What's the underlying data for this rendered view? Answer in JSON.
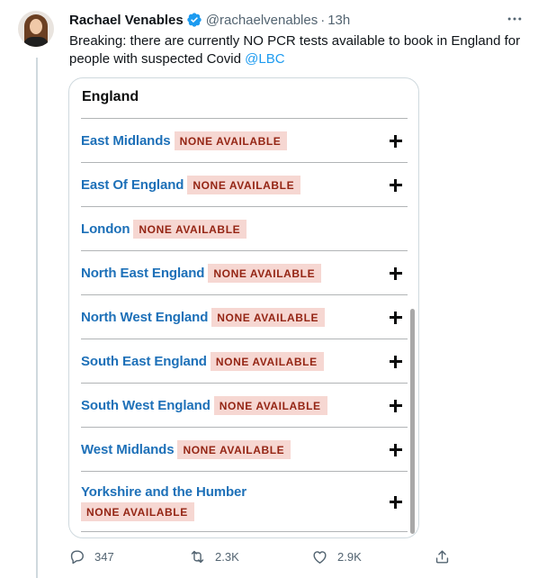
{
  "tweet": {
    "author_name": "Rachael Venables",
    "handle": "@rachaelvenables",
    "separator": "·",
    "time": "13h",
    "text": "Breaking: there are currently NO PCR tests available to book in England for people with suspected Covid ",
    "mention": "@LBC",
    "more_icon": "more-horizontal-icon",
    "verified_icon": "verified-badge-icon",
    "colors": {
      "accent": "#1d9bf0",
      "verified": "#1d9bf0",
      "secondary_text": "#536471"
    }
  },
  "card": {
    "title": "England",
    "status_label": "NONE AVAILABLE",
    "colors": {
      "region_link": "#1d70b8",
      "tag_bg": "#f6d7d2",
      "tag_text": "#942514"
    },
    "regions": [
      {
        "name": "East Midlands",
        "status": "NONE AVAILABLE",
        "expand": true
      },
      {
        "name": "East Of England",
        "status": "NONE AVAILABLE",
        "expand": true
      },
      {
        "name": "London",
        "status": "NONE AVAILABLE",
        "expand": false
      },
      {
        "name": "North East England",
        "status": "NONE AVAILABLE",
        "expand": true
      },
      {
        "name": "North West England",
        "status": "NONE AVAILABLE",
        "expand": true
      },
      {
        "name": "South East England",
        "status": "NONE AVAILABLE",
        "expand": true
      },
      {
        "name": "South West England",
        "status": "NONE AVAILABLE",
        "expand": true
      },
      {
        "name": "West Midlands",
        "status": "NONE AVAILABLE",
        "expand": true
      },
      {
        "name": "Yorkshire and the Humber",
        "status": "NONE AVAILABLE",
        "expand": true
      }
    ]
  },
  "actions": {
    "replies": "347",
    "retweets": "2.3K",
    "likes": "2.9K",
    "icons": [
      "reply-icon",
      "retweet-icon",
      "like-icon",
      "share-icon"
    ]
  }
}
